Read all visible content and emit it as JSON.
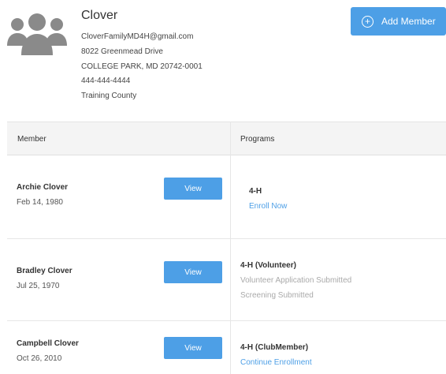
{
  "family": {
    "name": "Clover",
    "email": "CloverFamilyMD4H@gmail.com",
    "street": "8022 Greenmead Drive",
    "city_line": "COLLEGE PARK, MD 20742-0001",
    "phone": "444-444-4444",
    "county": "Training County",
    "icon": "family-group-icon"
  },
  "actions": {
    "add_member_label": "Add Member",
    "add_member_icon": "plus-circle-icon"
  },
  "table": {
    "headers": {
      "member": "Member",
      "programs": "Programs"
    },
    "rows": [
      {
        "name": "Archie Clover",
        "dob": "Feb 14, 1980",
        "view_label": "View",
        "program": "4-H",
        "link": "Enroll Now"
      },
      {
        "name": "Bradley Clover",
        "dob": "Jul 25, 1970",
        "view_label": "View",
        "program": "4-H (Volunteer)",
        "statuses": [
          "Volunteer Application Submitted",
          "Screening Submitted"
        ]
      },
      {
        "name": "Campbell Clover",
        "dob": "Oct 26, 2010",
        "view_label": "View",
        "program": "4-H (ClubMember)",
        "link": "Continue Enrollment"
      }
    ]
  },
  "colors": {
    "accent": "#4d9fe6",
    "icon_gray": "#8a8a8a",
    "header_bg": "#f4f4f4"
  }
}
